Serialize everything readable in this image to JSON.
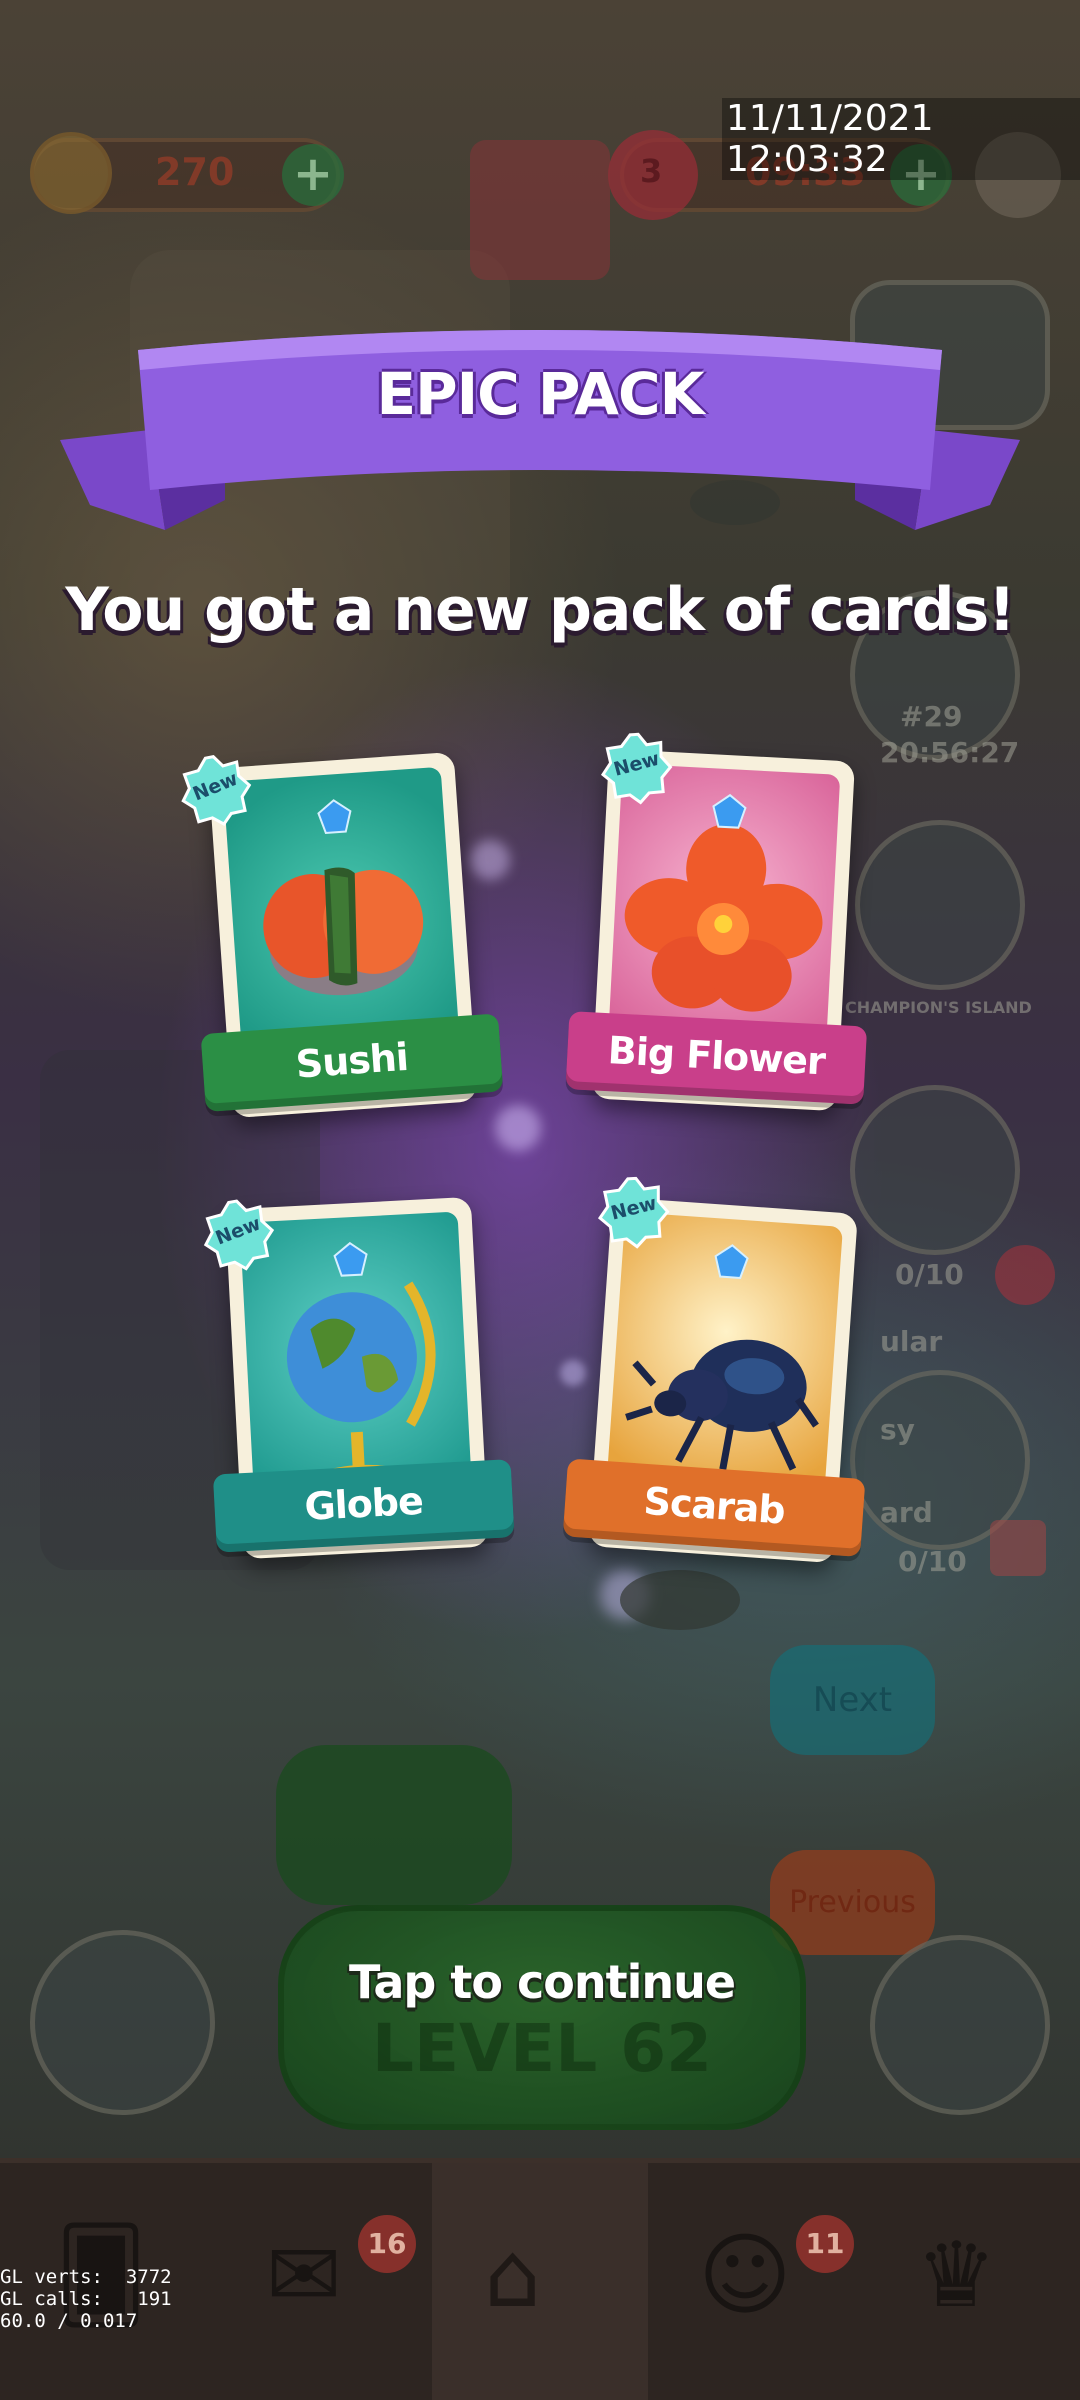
{
  "overlay": {
    "timestamp": "11/11/2021 12:03:32",
    "gl_stats": [
      "GL verts:  3772",
      "GL calls:   191",
      "60.0 / 0.017"
    ]
  },
  "hud": {
    "coins": "270",
    "lives": "3",
    "life_timer": "09:33"
  },
  "side_widgets": {
    "event_rank": "#29",
    "event_timer": "20:56:27",
    "champions_label": "CHAMPION'S ISLAND",
    "progress_1": "0/10",
    "progress_2": "0/10",
    "difficulty_1": "ular",
    "difficulty_2": "sy",
    "difficulty_3": "ard",
    "next_label": "Next",
    "previous_label": "Previous"
  },
  "level_ghost": "LEVEL 62",
  "nav": {
    "mail_badge": "16",
    "team_badge": "11"
  },
  "modal": {
    "title": "EPIC PACK",
    "message": "You got a new pack of cards!",
    "continue_label": "Tap to continue",
    "new_badge": "New",
    "cards": [
      {
        "name": "Sushi",
        "art_icon": "sushi-icon",
        "is_new": true
      },
      {
        "name": "Big Flower",
        "art_icon": "flower-icon",
        "is_new": true
      },
      {
        "name": "Globe",
        "art_icon": "globe-icon",
        "is_new": true
      },
      {
        "name": "Scarab",
        "art_icon": "scarab-icon",
        "is_new": true
      }
    ]
  },
  "colors": {
    "ribbon": "#8f5fe0",
    "sushi_card": "#1f9a87",
    "sushi_banner": "#2b8f45",
    "flower_card": "#e07aa6",
    "flower_banner": "#c93f8a",
    "globe_card": "#27a79b",
    "globe_banner": "#1f8f88",
    "scarab_card": "#e7a43d",
    "scarab_banner": "#e0702a",
    "new_badge": "#6fe3d8",
    "gem": "#3b9bf0"
  }
}
